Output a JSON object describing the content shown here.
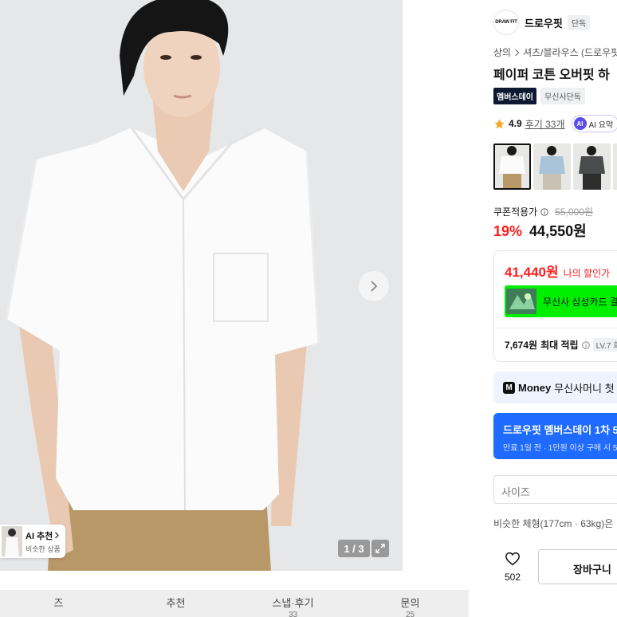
{
  "gallery": {
    "counter": "1 / 3",
    "ai_recommend": {
      "title": "AI 추천",
      "subtitle": "비슷한 상품"
    }
  },
  "tabs": [
    {
      "label": "즈",
      "sub": ""
    },
    {
      "label": "추천",
      "sub": ""
    },
    {
      "label": "스냅·후기",
      "sub": "33"
    },
    {
      "label": "문의",
      "sub": "25"
    }
  ],
  "product": {
    "brand": {
      "logo_text": "DRAW FIT",
      "name": "드로우핏",
      "tag": "단독"
    },
    "breadcrumb": [
      "상의",
      "셔츠/블라우스 (드로우핏"
    ],
    "title": "페이퍼 코튼 오버핏 하",
    "badges": [
      "멤버스데이",
      "무신사단독"
    ],
    "rating": {
      "score": "4.9",
      "reviews": "후기 33개",
      "ai_summary": "AI 요약"
    },
    "thumbnails": [
      {
        "color_name": "white",
        "selected": true
      },
      {
        "color_name": "light-blue",
        "selected": false
      },
      {
        "color_name": "charcoal",
        "selected": false
      }
    ],
    "price": {
      "coupon_label": "쿠폰적용가",
      "original": "55,000원",
      "discount_rate": "19%",
      "coupon_price": "44,550원",
      "my_price": "41,440원",
      "my_price_label": "나의 할인가"
    },
    "card_banner": "무신사 삼성카드 결",
    "points": {
      "amount": "7,674원",
      "label": "최대 적립",
      "level": "LV.7 회"
    },
    "money_bar": {
      "logo": "M",
      "brand": "Money",
      "text": "무신사머니 첫 결"
    },
    "promo": {
      "line1": "드로우핏 멤버스데이 1차 5%",
      "line2": "만료 1일 전 · 1만원 이상 구매 시 5"
    },
    "size_placeholder": "사이즈",
    "similar_body": "비슷한 체형(177cm · 63kg)은",
    "like_count": "502",
    "cart_label": "장바구니"
  },
  "colors": {
    "accent_red": "#ff1e1e",
    "promo_blue": "#1f6bff",
    "card_green": "#00ee00",
    "badge_navy": "#0b1a31"
  }
}
